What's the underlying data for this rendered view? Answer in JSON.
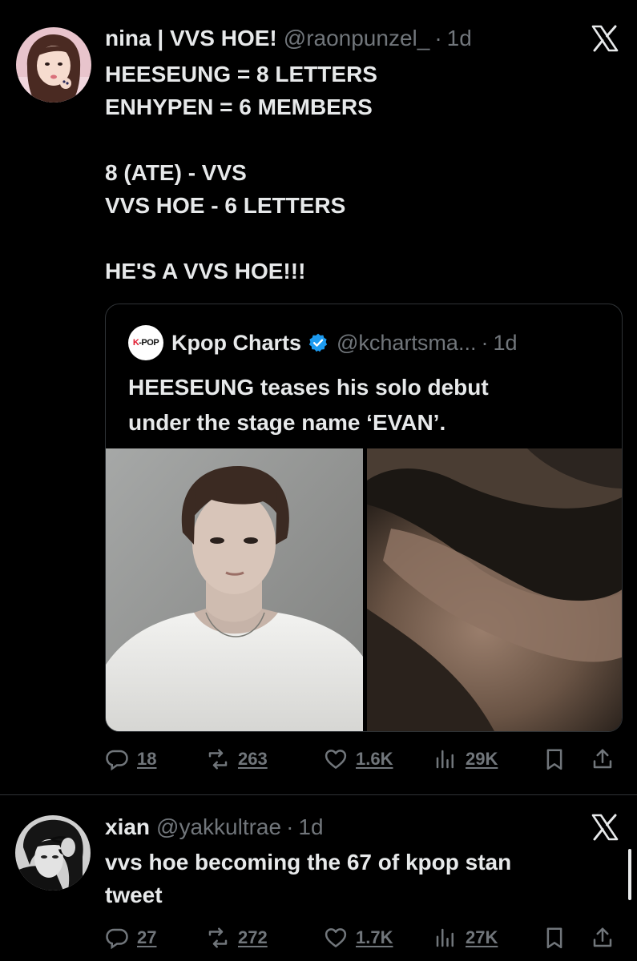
{
  "tweets": [
    {
      "author_name": "nina | VVS HOE!",
      "handle": "@raonpunzel_",
      "separator": "·",
      "time": "1d",
      "lines": [
        "HEESEUNG = 8 LETTERS",
        "ENHYPEN = 6 MEMBERS",
        "",
        "8 (ATE) - VVS",
        "VVS HOE - 6 LETTERS",
        "",
        "HE'S A VVS HOE!!!"
      ],
      "quote": {
        "logo_text_k": "K",
        "logo_text_rest": "-POP",
        "author_name": "Kpop Charts",
        "handle": "@kchartsma...",
        "separator": "·",
        "time": "1d",
        "lines": [
          "HEESEUNG teases his solo debut",
          "under the stage name ‘EVAN’."
        ]
      },
      "actions": {
        "replies": "18",
        "reposts": "263",
        "likes": "1.6K",
        "views": "29K"
      }
    },
    {
      "author_name": "xian",
      "handle": "@yakkultrae",
      "separator": "·",
      "time": "1d",
      "lines": [
        "vvs hoe becoming the 67 of kpop stan",
        "tweet"
      ],
      "actions": {
        "replies": "27",
        "reposts": "272",
        "likes": "1.7K",
        "views": "27K"
      }
    }
  ],
  "icons": {
    "reply": "reply-icon",
    "repost": "repost-icon",
    "like": "heart-icon",
    "views": "views-icon",
    "bookmark": "bookmark-icon",
    "share": "share-icon",
    "x_logo": "x-logo-icon",
    "verified": "verified-badge-icon"
  },
  "colors": {
    "background": "#000000",
    "text": "#e7e9ea",
    "muted": "#71767b",
    "border": "#2f3336",
    "verified": "#1d9bf0"
  }
}
